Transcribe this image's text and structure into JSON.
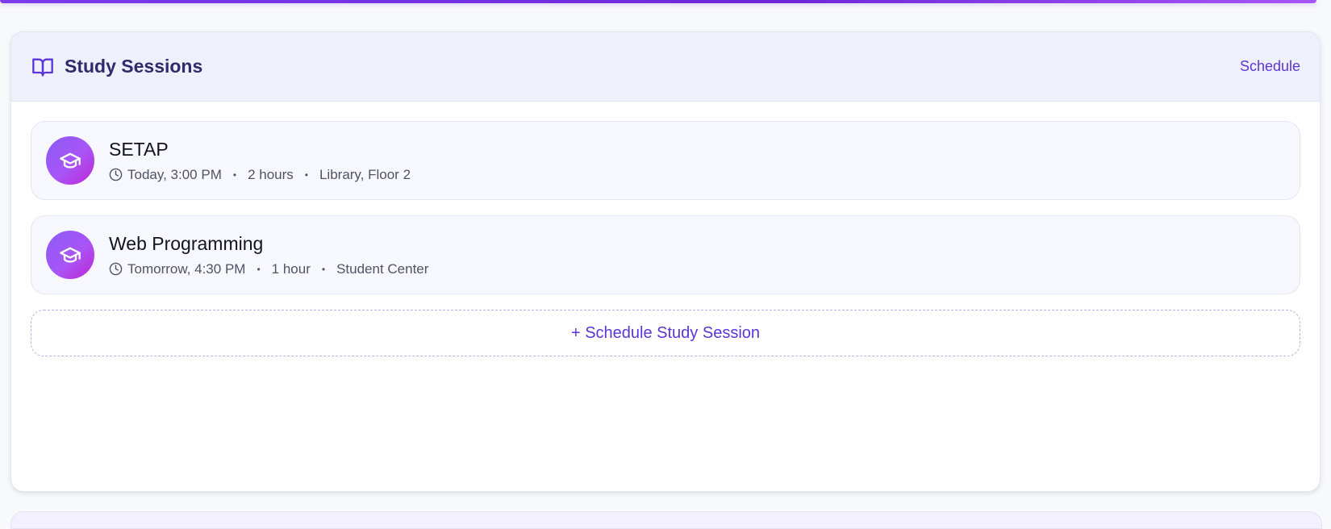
{
  "card": {
    "title": "Study Sessions",
    "header_icon": "book-open-icon",
    "schedule_link": "Schedule"
  },
  "sessions": [
    {
      "title": "SETAP",
      "icon": "graduation-cap-icon",
      "time": "Today, 3:00 PM",
      "duration": "2 hours",
      "location": "Library, Floor 2"
    },
    {
      "title": "Web Programming",
      "icon": "graduation-cap-icon",
      "time": "Tomorrow, 4:30 PM",
      "duration": "1 hour",
      "location": "Student Center"
    }
  ],
  "add_button": "+ Schedule Study Session",
  "colors": {
    "accent": "#5b35d5",
    "header_bg": "#eef1fc",
    "title": "#2e2a6b",
    "avatar_gradient_start": "#8b5cf6",
    "avatar_gradient_end": "#c026d3"
  }
}
